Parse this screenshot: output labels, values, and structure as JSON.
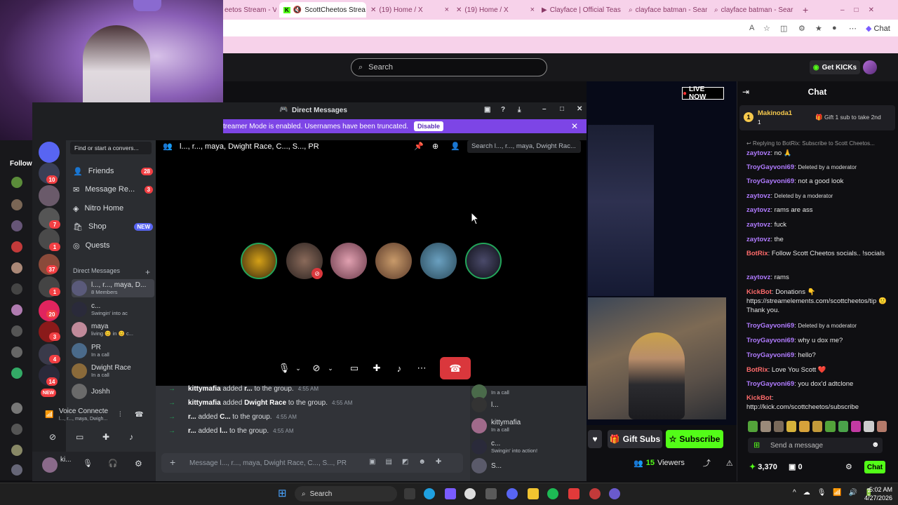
{
  "browser": {
    "tabs": [
      {
        "label": "eetos Stream - V",
        "active": false
      },
      {
        "label": "ScottCheetos Strea",
        "active": true
      },
      {
        "label": "(19) Home / X",
        "active": false
      },
      {
        "label": "(19) Home / X",
        "active": false
      },
      {
        "label": "Clayface | Official Teas",
        "active": false
      },
      {
        "label": "clayface batman - Sear",
        "active": false
      },
      {
        "label": "clayface batman - Sear",
        "active": false
      }
    ],
    "add_tab": "+",
    "copilot_label": "Chat"
  },
  "kick": {
    "search_placeholder": "Search",
    "get_kicks": "Get KICKs",
    "followed_label": "Followi",
    "live_now": "LIVE NOW",
    "gift_subs": "Gift Subs",
    "subscribe": "Subscribe",
    "viewers_count": "15",
    "viewers_label": "Viewers"
  },
  "chat": {
    "header": "Chat",
    "pinned_user": "Makinoda1",
    "pinned_user_sub": "1",
    "pinned_text": "Gift 1 sub to take 2nd",
    "reply_hint": "Replying to BotRix: Subscribe to Scott Cheetos...",
    "messages": [
      {
        "user": "zaytovz",
        "color": "#b07bff",
        "text": "no 🙏"
      },
      {
        "user": "TroyGayvoni69",
        "color": "#b07bff",
        "text": "Deleted by a moderator"
      },
      {
        "user": "TroyGayvoni69",
        "color": "#b07bff",
        "text": "not a good look"
      },
      {
        "user": "zaytovz",
        "color": "#b07bff",
        "text": "Deleted by a moderator"
      },
      {
        "user": "zaytovz",
        "color": "#b07bff",
        "text": "rams are ass"
      },
      {
        "user": "zaytovz",
        "color": "#b07bff",
        "text": "fuck"
      },
      {
        "user": "zaytovz",
        "color": "#b07bff",
        "text": "the"
      },
      {
        "user": "BotRix",
        "color": "#ff6b6b",
        "text": "Follow Scott Cheetos socials.. !socials"
      },
      {
        "user": "zaytovz",
        "color": "#b07bff",
        "text": "rams"
      },
      {
        "user": "KickBot",
        "color": "#ff6b6b",
        "text": "Donations 👇 https://streamelements.com/scottcheetos/tip 🙂 Thank you."
      },
      {
        "user": "TroyGayvoni69",
        "color": "#b07bff",
        "text": "Deleted by a moderator"
      },
      {
        "user": "TroyGayvoni69",
        "color": "#b07bff",
        "text": "why u dox me?"
      },
      {
        "user": "TroyGayvoni69",
        "color": "#b07bff",
        "text": "hello?"
      },
      {
        "user": "BotRix",
        "color": "#ff6b6b",
        "text": "Love You Scott ❤️"
      },
      {
        "user": "TroyGayvoni69",
        "color": "#b07bff",
        "text": "you dox'd adtclone"
      },
      {
        "user": "KickBot",
        "color": "#ff6b6b",
        "text": "http://kick.com/scottcheetos/subscribe"
      }
    ],
    "input_placeholder": "Send a message",
    "points": "3,370",
    "points2": "0",
    "chat_button": "Chat"
  },
  "discord": {
    "window_title": "Direct Messages",
    "streamer_banner": "treamer Mode is enabled. Usernames have been truncated.",
    "disable_button": "Disable",
    "find_conversation": "Find or start a convers...",
    "nav": [
      {
        "label": "Friends",
        "badge": "28"
      },
      {
        "label": "Message Re...",
        "badge": "3"
      },
      {
        "label": "Nitro Home",
        "badge": ""
      },
      {
        "label": "Shop",
        "badge": "NEW"
      },
      {
        "label": "Quests",
        "badge": ""
      }
    ],
    "dm_section": "Direct Messages",
    "dm_items": [
      {
        "name": "l..., r..., maya, D...",
        "sub": "8 Members"
      },
      {
        "name": "c...",
        "sub": "Swingin' into ac"
      },
      {
        "name": "maya",
        "sub": "living 😊 in 😊 c..."
      },
      {
        "name": "PR",
        "sub": "In a call"
      },
      {
        "name": "Dwight Race",
        "sub": "In a call"
      },
      {
        "name": "Joshh",
        "sub": ""
      }
    ],
    "server_badges": [
      "10",
      "7",
      "1",
      "37",
      "1",
      "20",
      "3",
      "4",
      "14"
    ],
    "new_badge": "NEW",
    "voice_connected": "Voice Connecte",
    "voice_sub": "l..., r..., maya, Dwigh...",
    "user_name": "ki...",
    "call_title": "l..., r..., maya, Dwight Race, C..., S..., PR",
    "call_search": "Search l..., r..., maya, Dwight Rac...",
    "system_messages": [
      {
        "actor": "kittymafia",
        "verb": "added",
        "target": "r...",
        "tail": "to the group.",
        "time": "4:55 AM"
      },
      {
        "actor": "kittymafia",
        "verb": "added",
        "target": "Dwight Race",
        "tail": "to the group.",
        "time": "4:55 AM"
      },
      {
        "actor": "r...",
        "verb": "added",
        "target": "C...",
        "tail": "to the group.",
        "time": "4:55 AM"
      },
      {
        "actor": "r...",
        "verb": "added",
        "target": "l...",
        "tail": "to the group.",
        "time": "4:55 AM"
      }
    ],
    "message_placeholder": "Message l..., r..., maya, Dwight Race, C..., S..., PR",
    "members": [
      {
        "name": "",
        "sub": "In a call"
      },
      {
        "name": "l...",
        "sub": ""
      },
      {
        "name": "kittymafia",
        "sub": "In a call"
      },
      {
        "name": "c...",
        "sub": "Swingin' into action!"
      },
      {
        "name": "S...",
        "sub": ""
      }
    ]
  },
  "taskbar": {
    "search": "Search",
    "time": "5:02 AM",
    "date": "4/27/2026"
  }
}
